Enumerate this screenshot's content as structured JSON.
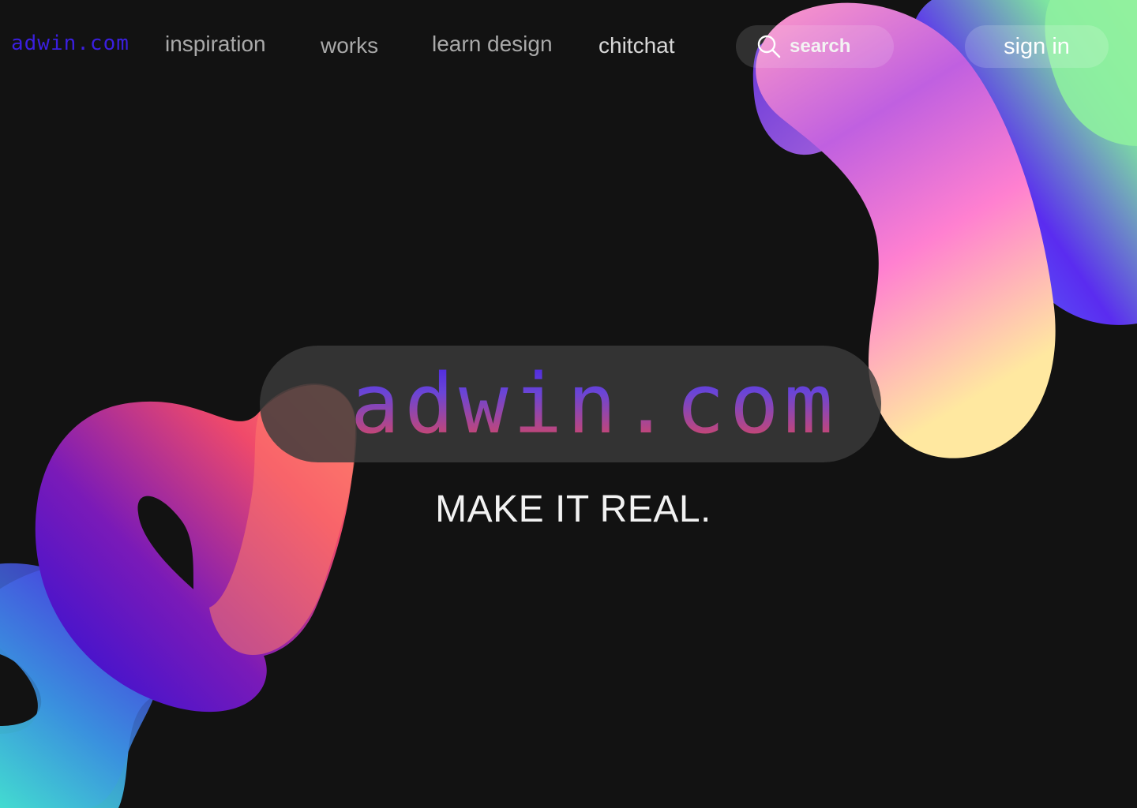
{
  "brand": {
    "logo_text": "adwin.com",
    "hero_logo_text": "adwin.com",
    "tagline": "MAKE IT REAL."
  },
  "nav": {
    "items": [
      {
        "label": "inspiration"
      },
      {
        "label": "works"
      },
      {
        "label": "learn design"
      },
      {
        "label": "chitchat"
      }
    ]
  },
  "search": {
    "label": "search",
    "icon": "search-icon"
  },
  "auth": {
    "sign_in_label": "sign in"
  },
  "colors": {
    "background": "#121212",
    "brand_blue": "#3b1fe0",
    "nav_text": "#a9a9a9"
  }
}
